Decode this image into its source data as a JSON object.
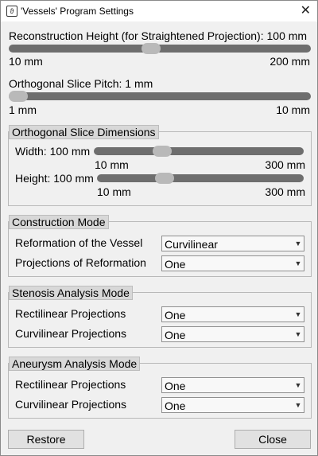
{
  "window": {
    "title": "'Vessels' Program Settings",
    "close_glyph": "✕"
  },
  "reconstruction": {
    "label": "Reconstruction Height (for Straightened Projection): 100 mm",
    "min": "10 mm",
    "max": "200 mm",
    "value_fraction": 0.47
  },
  "pitch": {
    "label": "Orthogonal Slice Pitch: 1 mm",
    "min": "1 mm",
    "max": "10 mm",
    "value_fraction": 0.0
  },
  "dimensions": {
    "title": "Orthogonal Slice Dimensions",
    "width": {
      "label": "Width: 100 mm",
      "min": "10 mm",
      "max": "300 mm",
      "value_fraction": 0.31
    },
    "height": {
      "label": "Height: 100 mm",
      "min": "10 mm",
      "max": "300 mm",
      "value_fraction": 0.31
    }
  },
  "construction": {
    "title": "Construction Mode",
    "rows": [
      {
        "label": "Reformation of the Vessel",
        "value": "Curvilinear"
      },
      {
        "label": "Projections of Reformation",
        "value": "One"
      }
    ]
  },
  "stenosis": {
    "title": "Stenosis Analysis Mode",
    "rows": [
      {
        "label": "Rectilinear Projections",
        "value": "One"
      },
      {
        "label": "Curvilinear Projections",
        "value": "One"
      }
    ]
  },
  "aneurysm": {
    "title": "Aneurysm Analysis Mode",
    "rows": [
      {
        "label": "Rectilinear Projections",
        "value": "One"
      },
      {
        "label": "Curvilinear Projections",
        "value": "One"
      }
    ]
  },
  "buttons": {
    "restore": "Restore",
    "close": "Close"
  },
  "icons": {
    "app": "vessels-app-icon",
    "dropdown": "chevron-down-icon"
  }
}
